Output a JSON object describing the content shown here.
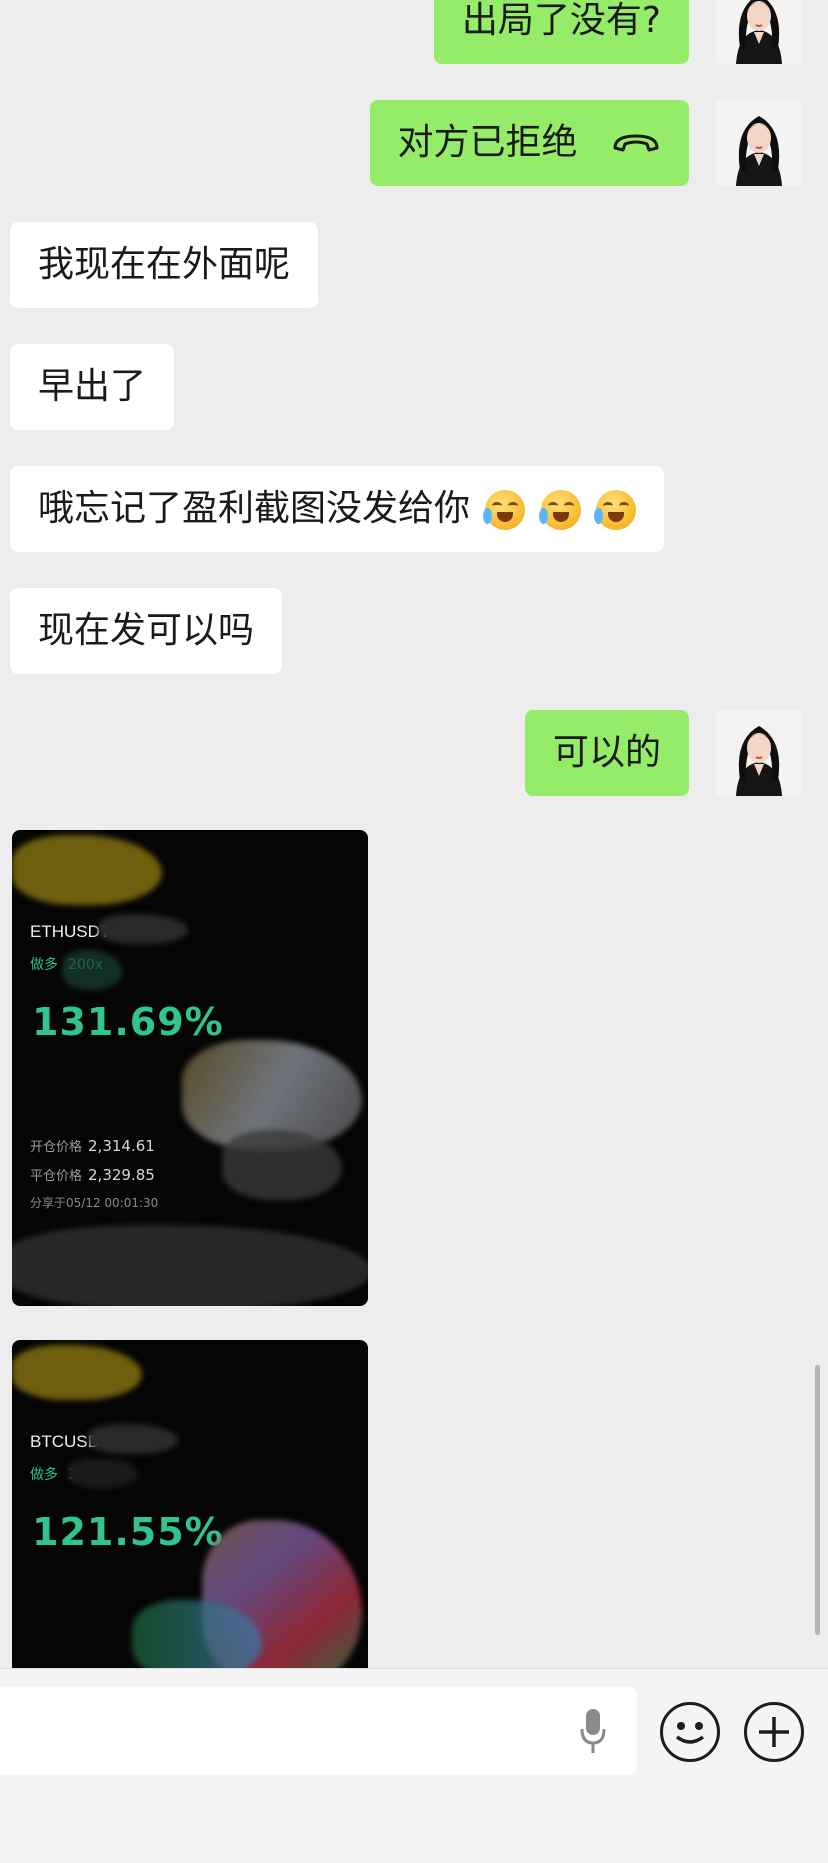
{
  "messages": [
    {
      "dir": "sent",
      "text": "出局了没有?"
    },
    {
      "dir": "sent",
      "text": "对方已拒绝"
    },
    {
      "dir": "recv",
      "text": "我现在在外面呢"
    },
    {
      "dir": "recv",
      "text": "早出了"
    },
    {
      "dir": "recv",
      "text": "哦忘记了盈利截图没发给你"
    },
    {
      "dir": "recv",
      "text": "现在发可以吗"
    },
    {
      "dir": "sent",
      "text": "可以的"
    }
  ],
  "cards": [
    {
      "pair": "ETHUSDT",
      "side": "做多",
      "leverage": "200x",
      "pnl": "131.69%",
      "open_label": "开仓价格",
      "open_price": "2,314.61",
      "close_label": "平仓价格",
      "close_price": "2,329.85",
      "share_time": "分享于05/12 00:01:30"
    },
    {
      "pair": "BTCUSDT",
      "side": "做多",
      "leverage": "2",
      "pnl": "121.55%"
    }
  ],
  "icons": {
    "call": "hangup-icon",
    "emoji_reaction": "crying-laughing-emoji",
    "mic": "microphone-icon",
    "emoji_button": "smiley-icon",
    "more": "plus-icon"
  },
  "colors": {
    "sent_bubble": "#95ec69",
    "recv_bubble": "#ffffff",
    "background": "#ededed",
    "profit_green": "#31c48d"
  }
}
